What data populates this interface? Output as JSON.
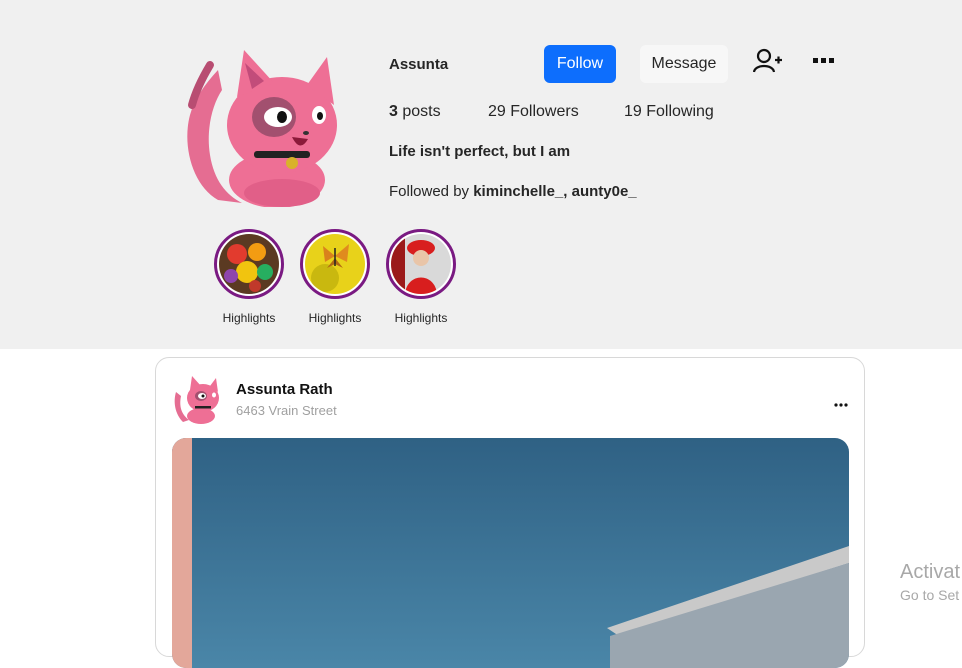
{
  "profile": {
    "username": "Assunta",
    "follow_label": "Follow",
    "message_label": "Message",
    "posts_count": "3",
    "posts_label": "posts",
    "followers_text": "29 Followers",
    "following_text": "19 Following",
    "bio": "Life isn't perfect, but I am",
    "followed_by_prefix": "Followed by",
    "followed_by_names": "kiminchelle_, aunty0e_"
  },
  "highlights": [
    {
      "label": "Highlights",
      "image": "fruits"
    },
    {
      "label": "Highlights",
      "image": "butterfly-yellow"
    },
    {
      "label": "Highlights",
      "image": "person-red"
    }
  ],
  "post": {
    "author": "Assunta Rath",
    "location": "6463 Vrain Street"
  },
  "watermark": {
    "title": "Activat",
    "subtitle": "Go to Set"
  },
  "colors": {
    "accent": "#0d6efd",
    "highlight_ring": "#7a1a82",
    "cat_pink": "#ee6f95"
  },
  "icons": [
    "add-user-icon",
    "more-icon",
    "cat-avatar"
  ]
}
